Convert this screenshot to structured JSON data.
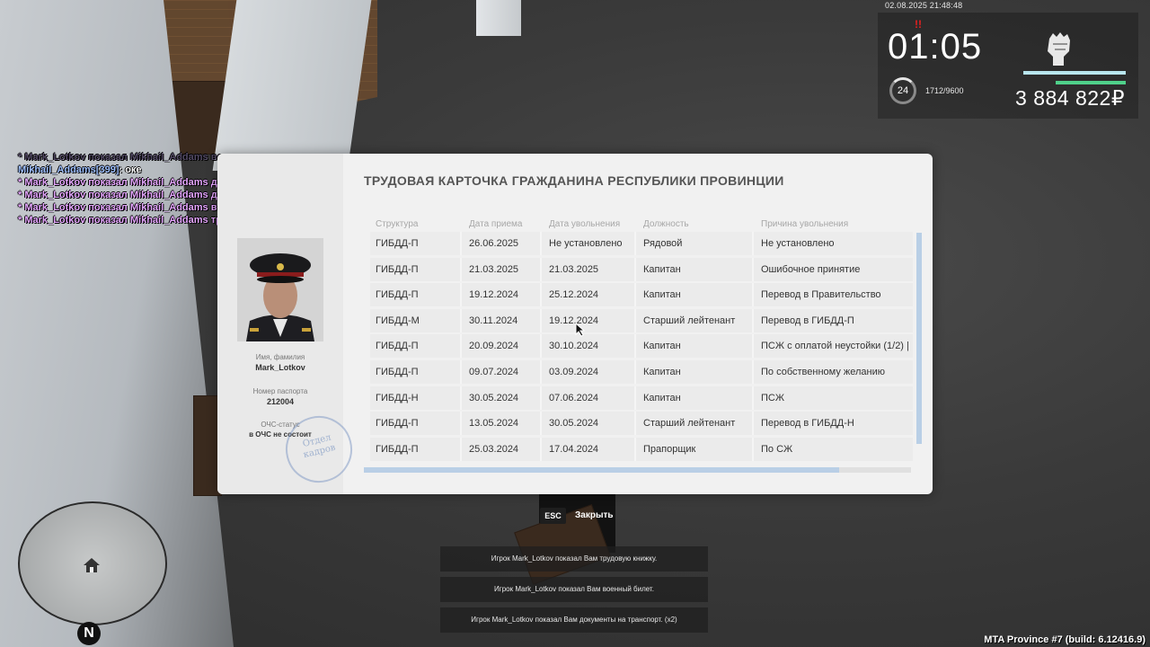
{
  "hud": {
    "datetime": "02.08.2025 21:48:48",
    "wanted": "!!",
    "clock": "01:05",
    "level": "24",
    "xp": "1712/9600",
    "money": "3 884 822₽",
    "armor_level": 1.0,
    "health_level": 0.68
  },
  "chat": {
    "faded_line": "* Mark_Lotkov показал Mikhail_Addams водительское удостоверение",
    "lines": [
      {
        "name": "Mikhail_Addams[399]",
        "text": ": оке"
      },
      {
        "text": "* Mark_Lotkov показал Mikhail_Addams документы на транспорт"
      },
      {
        "text": "* Mark_Lotkov показал Mikhail_Addams документы на транспорт"
      },
      {
        "text": "* Mark_Lotkov показал Mikhail_Addams военный билет"
      },
      {
        "text": "* Mark_Lotkov показал Mikhail_Addams трудовую книжку"
      }
    ]
  },
  "card": {
    "title": "ТРУДОВАЯ КАРТОЧКА ГРАЖДАНИНА РЕСПУБЛИКИ ПРОВИНЦИИ",
    "name_label": "Имя, фамилия",
    "name_value": "Mark_Lotkov",
    "passport_label": "Номер паспорта",
    "passport_value": "212004",
    "ochs_label": "ОЧС-статус",
    "ochs_value": "в ОЧС не состоит",
    "stamp_text": "Отдел кадров",
    "columns": [
      "Структура",
      "Дата приема",
      "Дата увольнения",
      "Должность",
      "Причина увольнения"
    ],
    "rows": [
      [
        "ГИБДД-П",
        "26.06.2025",
        "Не установлено",
        "Рядовой",
        "Не установлено"
      ],
      [
        "ГИБДД-П",
        "21.03.2025",
        "21.03.2025",
        "Капитан",
        "Ошибочное принятие"
      ],
      [
        "ГИБДД-П",
        "19.12.2024",
        "25.12.2024",
        "Капитан",
        "Перевод в Правительство"
      ],
      [
        "ГИБДД-М",
        "30.11.2024",
        "19.12.2024",
        "Старший лейтенант",
        "Перевод в ГИБДД-П"
      ],
      [
        "ГИБДД-П",
        "20.09.2024",
        "30.10.2024",
        "Капитан",
        "ПСЖ с оплатой неустойки (1/2) |"
      ],
      [
        "ГИБДД-П",
        "09.07.2024",
        "03.09.2024",
        "Капитан",
        "По собственному желанию"
      ],
      [
        "ГИБДД-Н",
        "30.05.2024",
        "07.06.2024",
        "Капитан",
        "ПСЖ"
      ],
      [
        "ГИБДД-П",
        "13.05.2024",
        "30.05.2024",
        "Старший лейтенант",
        "Перевод в ГИБДД-Н"
      ],
      [
        "ГИБДД-П",
        "25.03.2024",
        "17.04.2024",
        "Прапорщик",
        "По СЖ"
      ]
    ]
  },
  "close": {
    "key": "ESC",
    "label": "Закрыть"
  },
  "notifications": [
    "Игрок Mark_Lotkov показал Вам трудовую книжку.",
    "Игрок Mark_Lotkov показал Вам военный билет.",
    "Игрок Mark_Lotkov показал Вам документы на транспорт. (x2)"
  ],
  "minimap": {
    "north": "N"
  },
  "build": "MTA Province #7 (build: 6.12416.9)"
}
